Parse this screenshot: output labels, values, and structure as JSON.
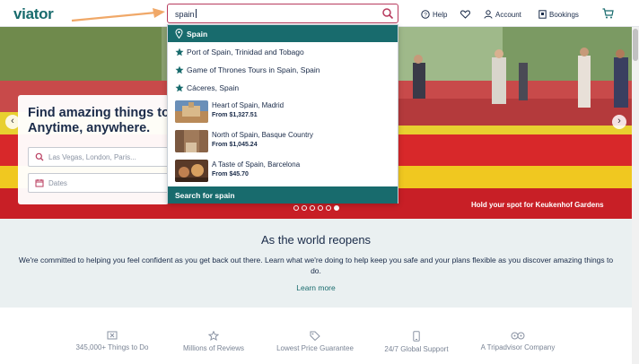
{
  "header": {
    "logo": "viator",
    "search": {
      "value": "spain"
    },
    "nav": {
      "help": "Help",
      "account": "Account",
      "bookings": "Bookings"
    }
  },
  "dropdown": {
    "selected": "Spain",
    "places": [
      "Port of Spain, Trinidad and Tobago",
      "Game of Thrones Tours in Spain, Spain",
      "Cáceres, Spain"
    ],
    "tours": [
      {
        "name": "Heart of Spain, Madrid",
        "price": "From $1,327.51"
      },
      {
        "name": "North of Spain, Basque Country",
        "price": "From $1,045.24"
      },
      {
        "name": "A Taste of Spain, Barcelona",
        "price": "From $45.70"
      }
    ],
    "footer": "Search for spain"
  },
  "hero": {
    "title_line1": "Find amazing things to",
    "title_line2": "Anytime, anywhere.",
    "location_placeholder": "Las Vegas, London, Paris...",
    "dates_placeholder": "Dates",
    "caption": "Hold your spot for Keukenhof Gardens",
    "carousel": {
      "total": 6,
      "active": 6
    }
  },
  "reopen": {
    "title": "As the world reopens",
    "text": "We're committed to helping you feel confident as you get back out there. Learn what we're doing to help keep you safe and your plans flexible as you discover amazing things to do.",
    "link": "Learn more"
  },
  "features": [
    "345,000+ Things to Do",
    "Millions of Reviews",
    "Lowest Price Guarantee",
    "24/7 Global Support",
    "A Tripadvisor Company"
  ],
  "colors": {
    "brand": "#186b6d",
    "search_border": "#b83b5e",
    "arrow": "#f0a868"
  }
}
